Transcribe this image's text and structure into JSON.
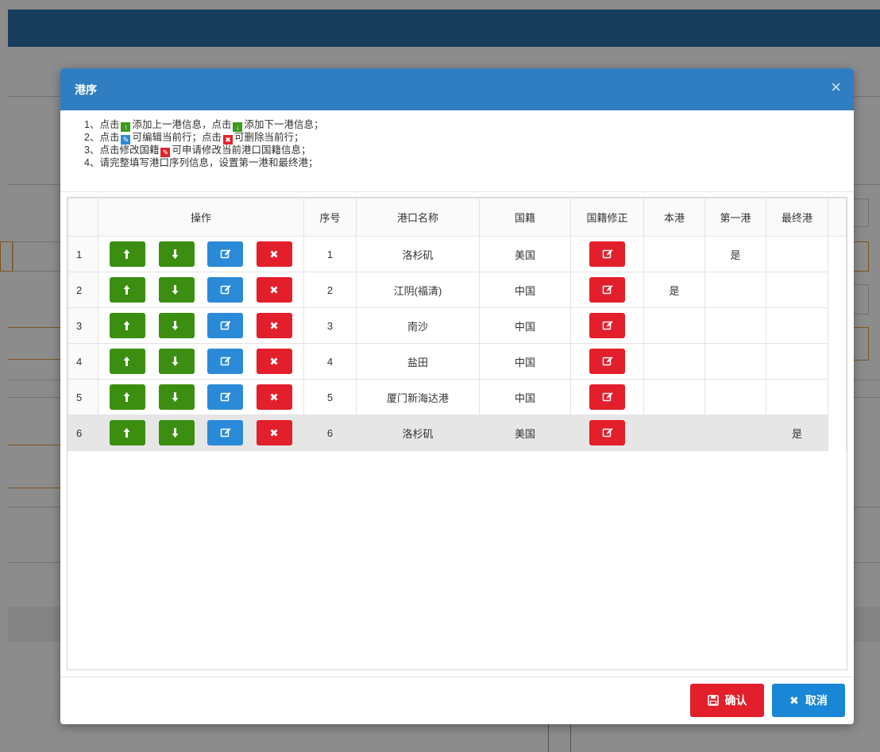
{
  "modal": {
    "title": "港序",
    "close_symbol": "×"
  },
  "instructions": {
    "line1_prefix": "1、点击",
    "line1_mid": "添加上一港信息，点击",
    "line1_suffix": "添加下一港信息；",
    "line2_prefix": "2、点击",
    "line2_mid": "可编辑当前行；点击",
    "line2_suffix": "可删除当前行；",
    "line3_prefix": "3、点击修改国籍",
    "line3_suffix": "可申请修改当前港口国籍信息；",
    "line4": "4、请完整填写港口序列信息，设置第一港和最终港；"
  },
  "table": {
    "headers": {
      "op": "操作",
      "seq": "序号",
      "port": "港口名称",
      "nation": "国籍",
      "nation_fix": "国籍修正",
      "this_port": "本港",
      "first_port": "第一港",
      "final_port": "最终港"
    },
    "rows": [
      {
        "num": "1",
        "seq": "1",
        "port": "洛杉矶",
        "nation": "美国",
        "this_port": "",
        "first_port": "是",
        "final_port": ""
      },
      {
        "num": "2",
        "seq": "2",
        "port": "江阴(福清)",
        "nation": "中国",
        "this_port": "是",
        "first_port": "",
        "final_port": ""
      },
      {
        "num": "3",
        "seq": "3",
        "port": "南沙",
        "nation": "中国",
        "this_port": "",
        "first_port": "",
        "final_port": ""
      },
      {
        "num": "4",
        "seq": "4",
        "port": "盐田",
        "nation": "中国",
        "this_port": "",
        "first_port": "",
        "final_port": ""
      },
      {
        "num": "5",
        "seq": "5",
        "port": "厦门新海达港",
        "nation": "中国",
        "this_port": "",
        "first_port": "",
        "final_port": ""
      },
      {
        "num": "6",
        "seq": "6",
        "port": "洛杉矶",
        "nation": "美国",
        "this_port": "",
        "first_port": "",
        "final_port": "是"
      }
    ],
    "selected_row": "6"
  },
  "footer": {
    "confirm_label": "确认",
    "cancel_label": "取消"
  },
  "colors": {
    "header_blue": "#2f7ec1",
    "green": "#3b8e10",
    "blue": "#2a8ad8",
    "red": "#e21f2b"
  },
  "icons": {
    "up": "arrow-up-icon",
    "down": "arrow-down-icon",
    "edit": "edit-icon",
    "delete": "delete-icon",
    "save": "save-icon"
  }
}
